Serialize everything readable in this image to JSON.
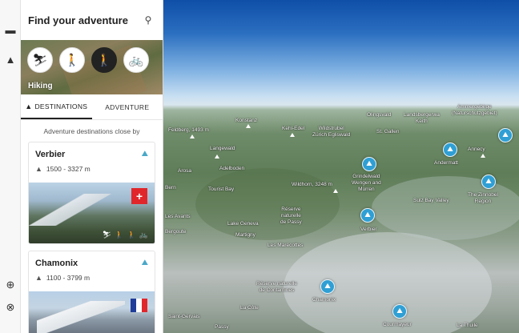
{
  "rail": {
    "icons": [
      "book-icon",
      "mountain-icon",
      "zoom-in-icon",
      "compass-icon"
    ]
  },
  "panel": {
    "title": "Find your adventure",
    "activities": [
      {
        "name": "ski-tour-icon",
        "glyph": "⛷"
      },
      {
        "name": "hiker-icon",
        "glyph": "🚶"
      },
      {
        "name": "hiking-icon",
        "glyph": "🚶",
        "active": true
      },
      {
        "name": "bike-icon",
        "glyph": "🚲"
      }
    ],
    "activity_label": "Hiking",
    "tabs": [
      {
        "label": "DESTINATIONS",
        "active": true
      },
      {
        "label": "ADVENTURE",
        "active": false
      }
    ],
    "near_label": "Adventure destinations close by",
    "cards": [
      {
        "title": "Verbier",
        "altitude": "1500 - 3327 m",
        "flag": "ch"
      },
      {
        "title": "Chamonix",
        "altitude": "1100 - 3799 m",
        "flag": "fr"
      }
    ]
  },
  "map": {
    "labels": [
      {
        "text": "Feldberg, 1493 m"
      },
      {
        "text": "Konstanz"
      },
      {
        "text": "Kehl-Edel"
      },
      {
        "text": "Wildstrubel\nZürich Egliswald"
      },
      {
        "text": "Olingsvald"
      },
      {
        "text": "Landsbergerwa\nKeith"
      },
      {
        "text": "Ammergebirge\n(Naturschutzgebiet)"
      },
      {
        "text": "St. Gallen"
      },
      {
        "text": "Langewald"
      },
      {
        "text": "Arosa"
      },
      {
        "text": "Andermatt"
      },
      {
        "text": "Adelboden"
      },
      {
        "text": "Bern"
      },
      {
        "text": "Grindelwald\nWengen and\nMürren"
      },
      {
        "text": "Tourist Bay"
      },
      {
        "text": "Sulz Bay Valley"
      },
      {
        "text": "The Zinnobel\nRegion"
      },
      {
        "text": "Annecy"
      },
      {
        "text": "Wildhorn, 3248 m"
      },
      {
        "text": "Lake Geneva"
      },
      {
        "text": "Bergoute"
      },
      {
        "text": "Les Avants"
      },
      {
        "text": "Réserve\nnaturelle\nde Passy"
      },
      {
        "text": "Verbier"
      },
      {
        "text": "Martigny"
      },
      {
        "text": "Les Marécottes"
      },
      {
        "text": "Réserve naturelle\nde Contamines"
      },
      {
        "text": "Chamonix"
      },
      {
        "text": "La Côte"
      },
      {
        "text": "Courmayeur"
      },
      {
        "text": "La Thuile"
      },
      {
        "text": "Passy"
      },
      {
        "text": "Saint-Gervais"
      }
    ],
    "pins": [
      "Adelboden",
      "Verbier",
      "Chamonix",
      "Courmayeur",
      "Andermatt",
      "Zinnobel",
      "Ammergebirge"
    ]
  },
  "colors": {
    "pin": "#2f9fd4",
    "flag_ch_red": "#e0262b",
    "flag_fr_blue": "#1f3d99",
    "flag_fr_red": "#e0262b",
    "accent_dark": "#222222"
  }
}
